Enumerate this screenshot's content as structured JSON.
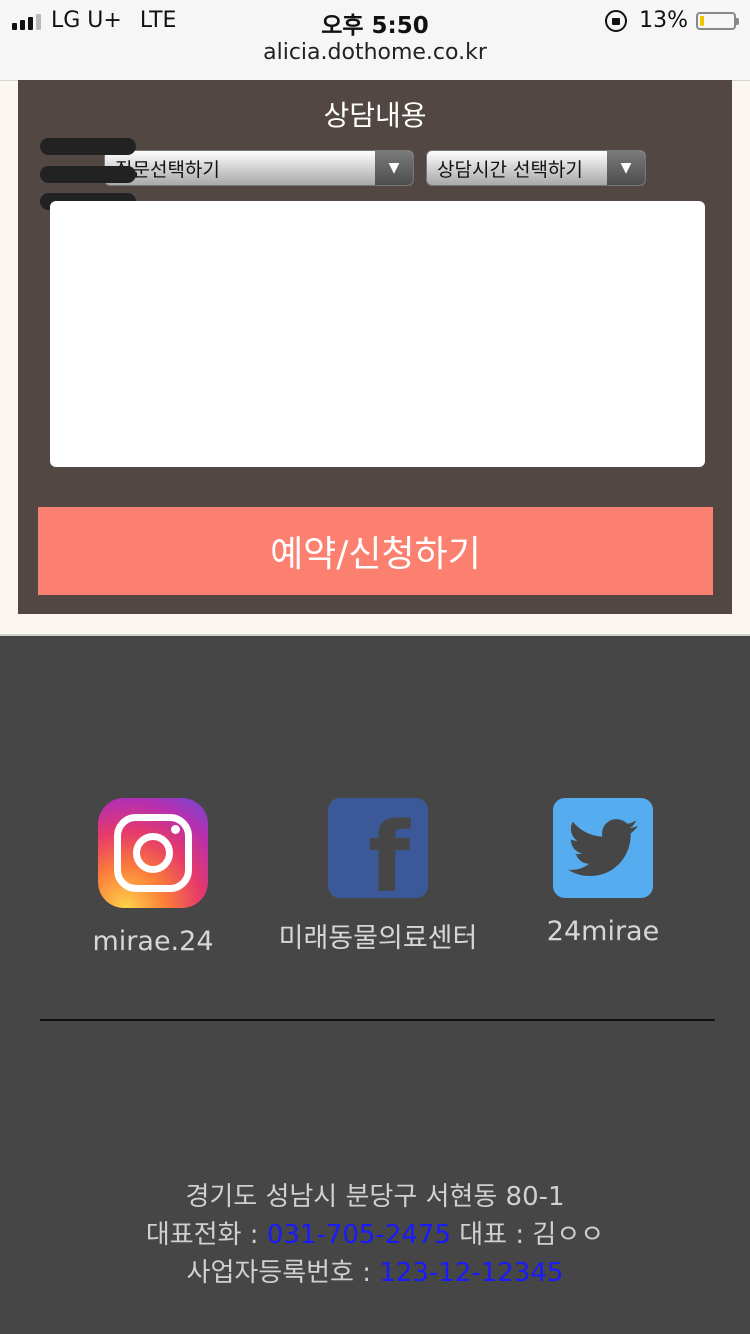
{
  "status_bar": {
    "carrier": "LG U+",
    "network": "LTE",
    "time": "오후 5:50",
    "battery_percent": "13%",
    "battery_level": 0.13,
    "url": "alicia.dothome.co.kr"
  },
  "form": {
    "title": "상담내용",
    "question_select": "질문선택하기",
    "time_select": "상담시간 선택하기",
    "textarea_value": "",
    "submit_label": "예약/신청하기"
  },
  "social": [
    {
      "icon": "instagram-icon",
      "caption": "mirae.24"
    },
    {
      "icon": "facebook-icon",
      "caption": "미래동물의료센터"
    },
    {
      "icon": "twitter-icon",
      "caption": "24mirae"
    }
  ],
  "footer": {
    "address": "경기도 성남시 분당구 서현동 80-1",
    "phone_label": "대표전화 : ",
    "phone": "031-705-2475",
    "ceo_label": " 대표 : 김ㅇㅇ",
    "biz_label": "사업자등록번호 : ",
    "biz_number": "123-12-12345"
  },
  "colors": {
    "form_background": "#534744",
    "submit_button": "#fb8070",
    "footer_background": "#464646",
    "link": "#1a1aff"
  }
}
